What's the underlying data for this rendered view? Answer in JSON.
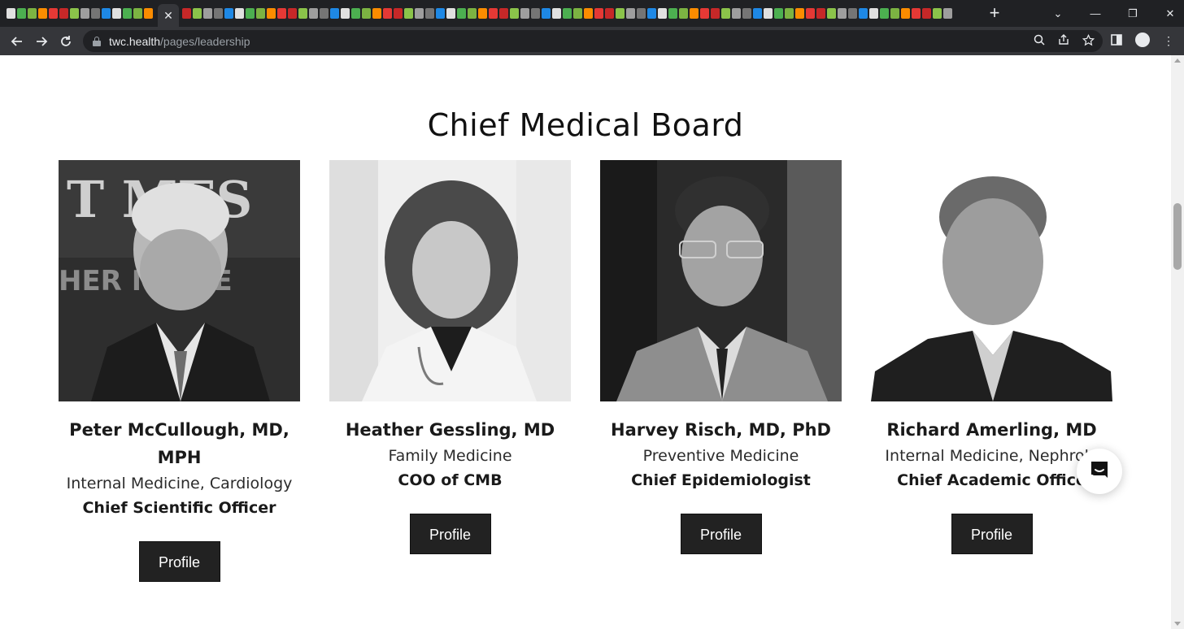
{
  "browser": {
    "url_host": "twc.health",
    "url_path": "/pages/leadership",
    "active_tab_close": "✕",
    "new_tab": "+",
    "window_controls": [
      "⌄",
      "—",
      "❐",
      "✕"
    ]
  },
  "section": {
    "title": "Chief Medical Board"
  },
  "members": [
    {
      "name": "Peter McCullough, MD, MPH",
      "specialty": "Internal Medicine, Cardiology",
      "role": "Chief Scientific Officer",
      "button": "Profile"
    },
    {
      "name": "Heather Gessling, MD",
      "specialty": "Family Medicine",
      "role": "COO of CMB",
      "button": "Profile"
    },
    {
      "name": "Harvey Risch, MD, PhD",
      "specialty": "Preventive Medicine",
      "role": "Chief Epidemiologist",
      "button": "Profile"
    },
    {
      "name": "Richard Amerling, MD",
      "specialty": "Internal Medicine, Nephrolo",
      "role": "Chief Academic Office",
      "button": "Profile"
    }
  ],
  "icons": {
    "back": "back-arrow-icon",
    "forward": "forward-arrow-icon",
    "reload": "reload-icon",
    "lock": "lock-icon",
    "zoom": "zoom-icon",
    "share": "share-icon",
    "bookmark": "star-icon",
    "sidepanel": "side-panel-icon",
    "profile": "profile-icon",
    "chat": "chat-icon"
  }
}
